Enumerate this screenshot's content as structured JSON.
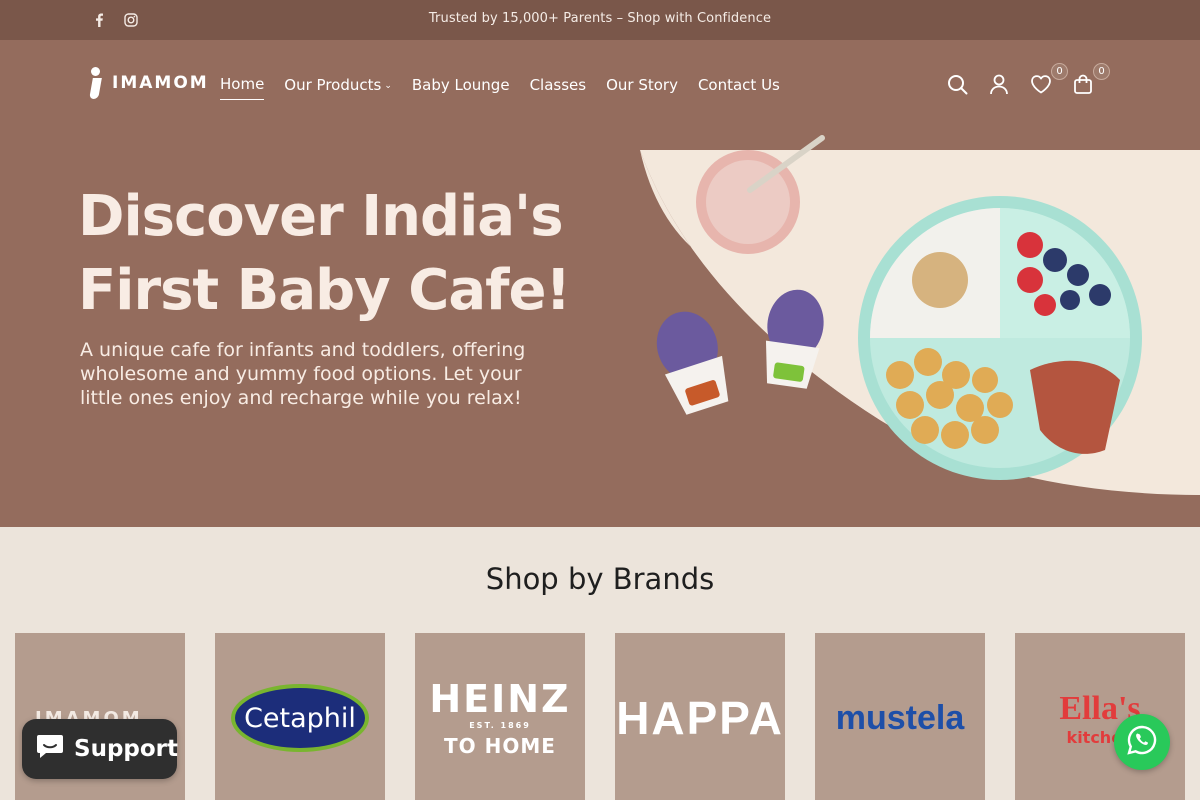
{
  "announcement": {
    "message": "Trusted by 15,000+ Parents – Shop with Confidence",
    "social_icons": [
      "facebook-icon",
      "instagram-icon"
    ]
  },
  "header": {
    "logo_text": "IMAMOM",
    "nav": [
      {
        "label": "Home",
        "active": true
      },
      {
        "label": "Our Products",
        "has_dropdown": true
      },
      {
        "label": "Baby Lounge"
      },
      {
        "label": "Classes"
      },
      {
        "label": "Our Story"
      },
      {
        "label": "Contact Us"
      }
    ],
    "icons": [
      "search-icon",
      "account-icon",
      "wishlist-icon",
      "cart-icon"
    ],
    "wishlist_count": "0",
    "cart_count": "0"
  },
  "hero": {
    "title_line1": "Discover India's",
    "title_line2": "First Baby Cafe!",
    "description": "A unique cafe for infants and toddlers, offering wholesome and yummy food options. Let your little ones enjoy and recharge while you relax!"
  },
  "brands": {
    "title": "Shop by Brands",
    "items": [
      {
        "name": "IMAMOM"
      },
      {
        "name": "Cetaphil"
      },
      {
        "name": "HEINZ",
        "tagline": "EST. 1869",
        "sub": "TO HOME"
      },
      {
        "name": "HAPPA"
      },
      {
        "name": "mustela"
      },
      {
        "name": "Ella's",
        "sub": "kitchen"
      }
    ]
  },
  "widgets": {
    "support_label": "Support",
    "whatsapp_icon": "whatsapp-icon"
  },
  "colors": {
    "announcement_bg": "#7a574a",
    "header_bg": "#946c5d",
    "page_bg": "#ece4db",
    "brand_tile_bg": "#b49c8e",
    "whatsapp_green": "#29c95a"
  }
}
